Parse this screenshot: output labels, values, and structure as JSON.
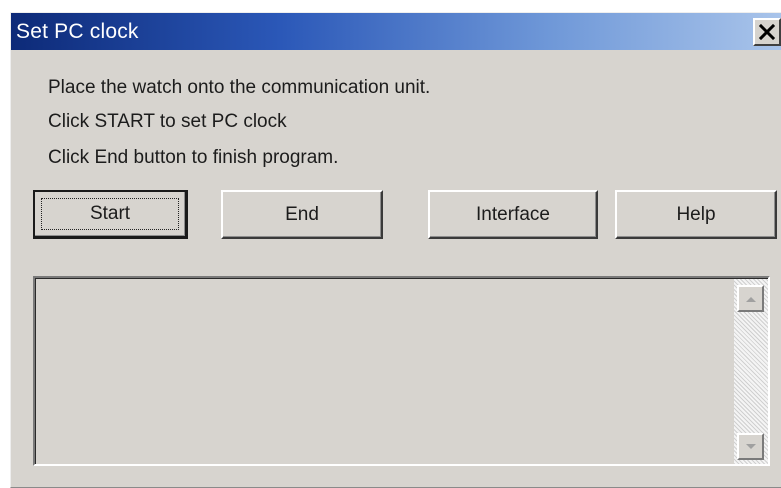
{
  "window": {
    "title": "Set PC clock",
    "close_symbol": "✕"
  },
  "messages": [
    "Place the watch onto the communication unit.",
    "Click START to set PC clock",
    "Click End button to finish program."
  ],
  "buttons": {
    "start": "Start",
    "end": "End",
    "interface": "Interface",
    "help": "Help"
  },
  "output": {
    "text": ""
  },
  "icons": {
    "close": "close-icon",
    "scroll_up": "scroll-up-arrow-icon",
    "scroll_down": "scroll-down-arrow-icon"
  },
  "colors": {
    "title_start": "#0d2a78",
    "title_end": "#a9c4ea",
    "window_bg": "#d7d4cf"
  }
}
